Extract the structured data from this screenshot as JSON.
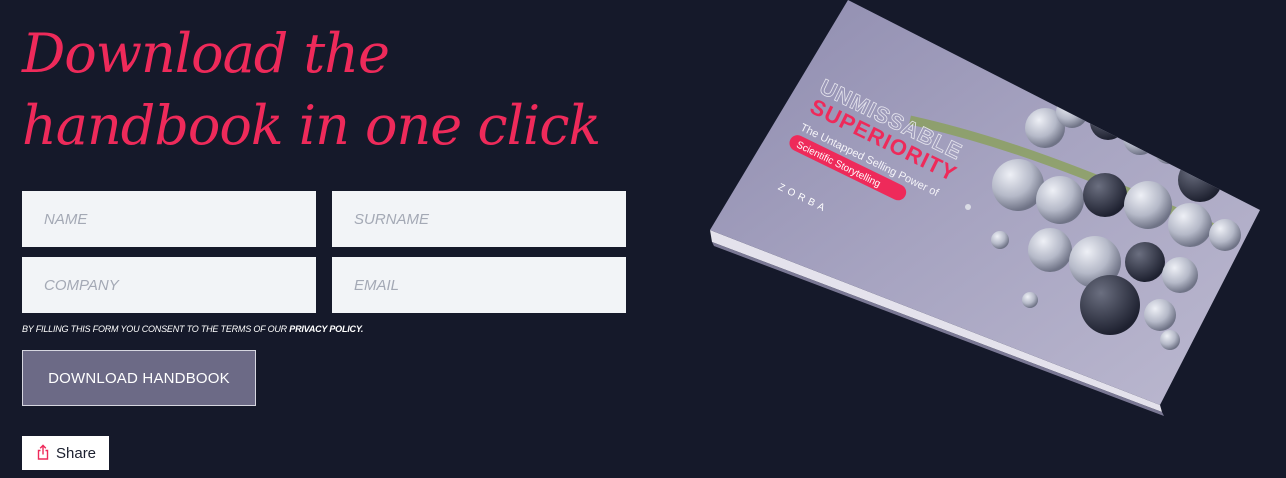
{
  "headline": {
    "line1": "Download the",
    "line2": "handbook in one click"
  },
  "form": {
    "name_placeholder": "NAME",
    "surname_placeholder": "SURNAME",
    "company_placeholder": "COMPANY",
    "email_placeholder": "EMAIL",
    "consent_text": "BY FILLING THIS FORM YOU CONSENT TO THE TERMS OF OUR ",
    "privacy_link": "PRIVACY POLICY.",
    "submit_label": "DOWNLOAD HANDBOOK"
  },
  "share": {
    "label": "Share",
    "icon": "share-icon"
  },
  "book_cover": {
    "title_outline": "UNMISSABLE",
    "title_main": "SUPERIORITY",
    "subtitle": "The Untapped Selling Power of",
    "tag": "Scientific Storytelling",
    "brand": "ZORBA"
  },
  "colors": {
    "background": "#15192a",
    "accent": "#ee2a5a",
    "input_bg": "#f2f4f7",
    "button_bg": "#6c6a86",
    "cover": "#9b98b5"
  }
}
